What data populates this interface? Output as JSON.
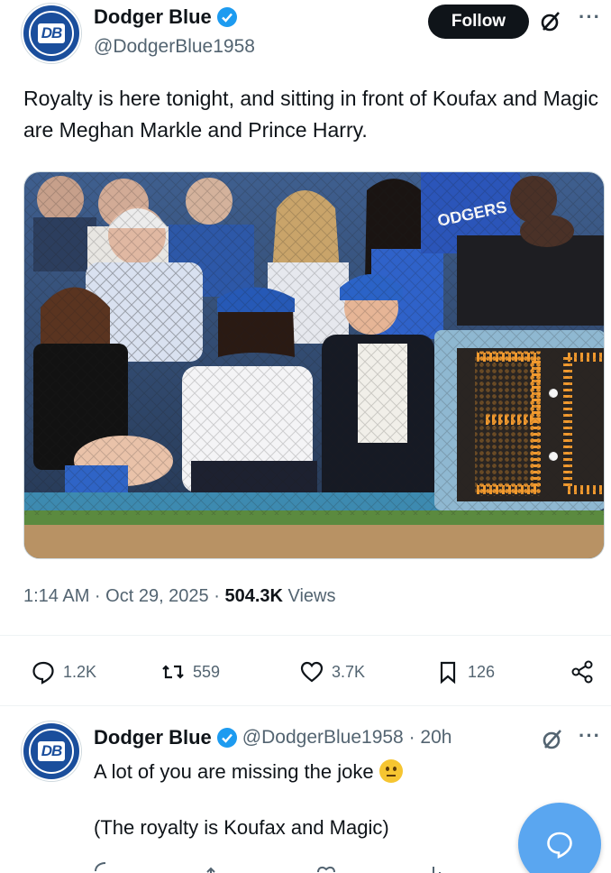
{
  "tweet": {
    "author_name": "Dodger Blue",
    "author_handle": "@DodgerBlue1958",
    "avatar_text": "DB",
    "follow_label": "Follow",
    "text": "Royalty is here tonight, and sitting in front of Koufax and Magic are Meghan Markle and Prince Harry.",
    "time": "1:14 AM · Oct 29, 2025 · ",
    "views_count": "504.3K",
    "views_label": " Views",
    "media_shot_clock_digits": "3",
    "actions": {
      "replies": "1.2K",
      "reposts": "559",
      "likes": "3.7K",
      "bookmarks": "126"
    }
  },
  "reply": {
    "author_name": "Dodger Blue",
    "author_handle": "@DodgerBlue1958 · 20h",
    "avatar_text": "DB",
    "line1": "A lot of you are missing the joke",
    "line2": "(The royalty is Koufax and Magic)"
  },
  "colors": {
    "accent": "#1d9bf0",
    "follow_bg": "#0f1419",
    "secondary_text": "#536471",
    "dodger_blue": "#1a4e9c",
    "fab": "#5aa6f0"
  },
  "icons": [
    "verified-badge-icon",
    "grok-icon",
    "more-icon",
    "reply-icon",
    "repost-icon",
    "like-icon",
    "bookmark-icon",
    "share-icon",
    "compose-icon",
    "emoji-icon"
  ]
}
